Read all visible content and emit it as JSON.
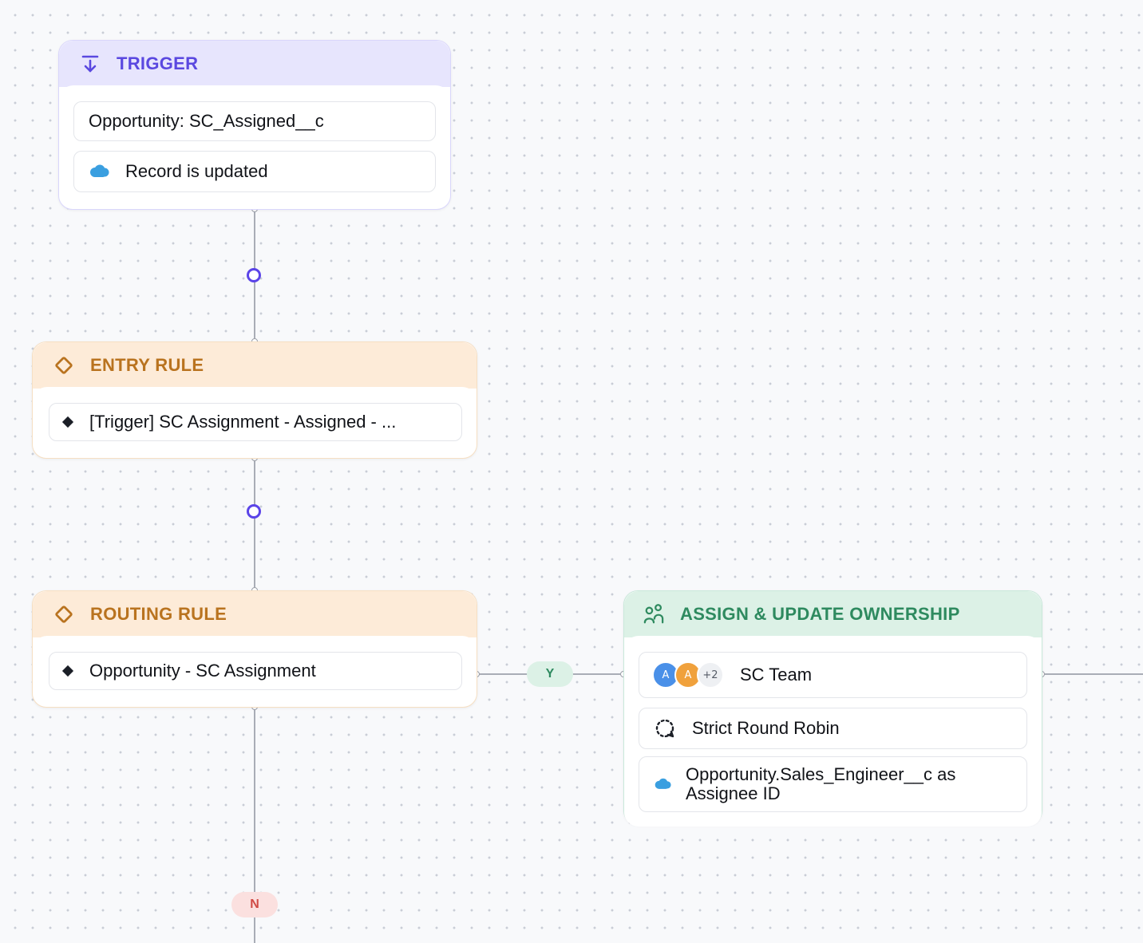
{
  "colors": {
    "trigger": "#5a48e0",
    "rule": "#b9731f",
    "assign": "#2e8a5f",
    "connector": "#5b44e8",
    "yes_pill": "#dcf1e6",
    "no_pill": "#fbe0df"
  },
  "trigger": {
    "icon": "arrow-down-to-line-icon",
    "title": "TRIGGER",
    "object_field": "Opportunity: SC_Assigned__c",
    "event": "Record is updated",
    "event_icon": "salesforce-cloud-icon"
  },
  "entry_rule": {
    "icon": "diamond-outline-icon",
    "title": "ENTRY RULE",
    "condition": "[Trigger] SC Assignment - Assigned - ..."
  },
  "routing_rule": {
    "icon": "diamond-outline-icon",
    "title": "ROUTING RULE",
    "condition": "Opportunity - SC Assignment"
  },
  "branches": {
    "yes": "Y",
    "no": "N"
  },
  "assign": {
    "icon": "people-icon",
    "title": "ASSIGN & UPDATE OWNERSHIP",
    "team": {
      "avatars": [
        "A",
        "A"
      ],
      "more": "+2",
      "name": "SC Team"
    },
    "method": "Strict Round Robin",
    "method_icon": "round-robin-icon",
    "assignee_line1": "Opportunity.Sales_Engineer__c as",
    "assignee_line2": "Assignee ID",
    "assignee_icon": "salesforce-cloud-icon"
  }
}
